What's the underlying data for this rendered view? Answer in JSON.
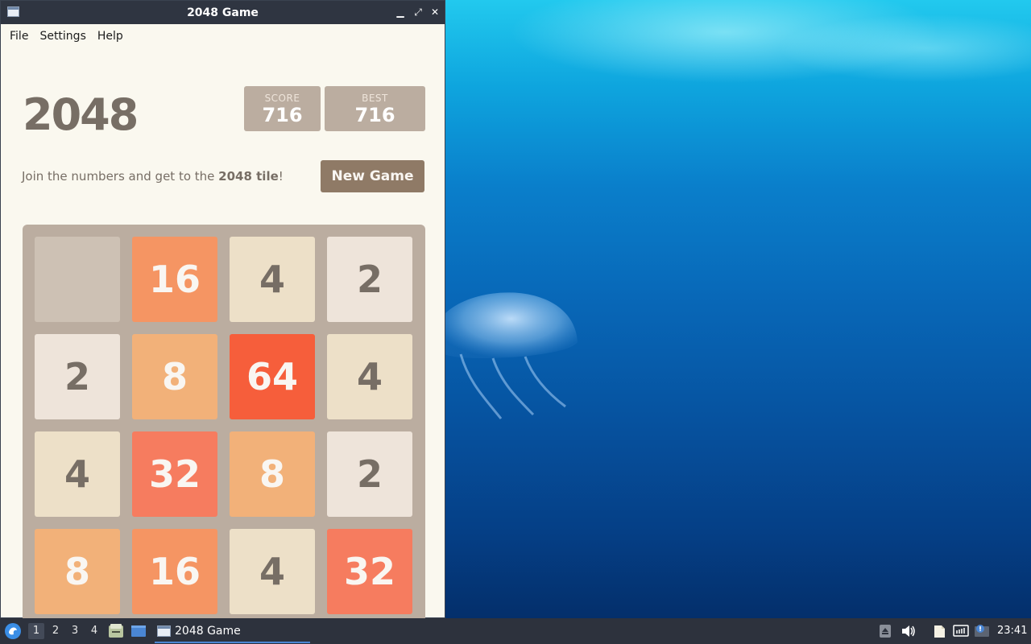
{
  "window": {
    "title": "2048 Game",
    "controls": [
      "minimize",
      "maximize",
      "close"
    ]
  },
  "menubar": {
    "items": [
      "File",
      "Settings",
      "Help"
    ]
  },
  "game": {
    "title": "2048",
    "score_label": "SCORE",
    "score_value": "716",
    "best_label": "BEST",
    "best_value": "716",
    "intro_prefix": "Join the numbers and get to the ",
    "intro_bold": "2048 tile",
    "intro_suffix": "!",
    "new_game_label": "New Game",
    "board": [
      [
        null,
        16,
        4,
        2
      ],
      [
        2,
        8,
        64,
        4
      ],
      [
        4,
        32,
        8,
        2
      ],
      [
        8,
        16,
        4,
        32
      ]
    ],
    "tile_colors": {
      "empty": "#cdc1b4",
      "2": "#eee4da",
      "4": "#ede0c8",
      "8": "#f2b179",
      "16": "#f59563",
      "32": "#f67c5f",
      "64": "#f65e3b"
    }
  },
  "taskbar": {
    "workspaces": [
      "1",
      "2",
      "3",
      "4"
    ],
    "active_workspace": "1",
    "task_label": "2048 Game",
    "clock": "23:41"
  }
}
